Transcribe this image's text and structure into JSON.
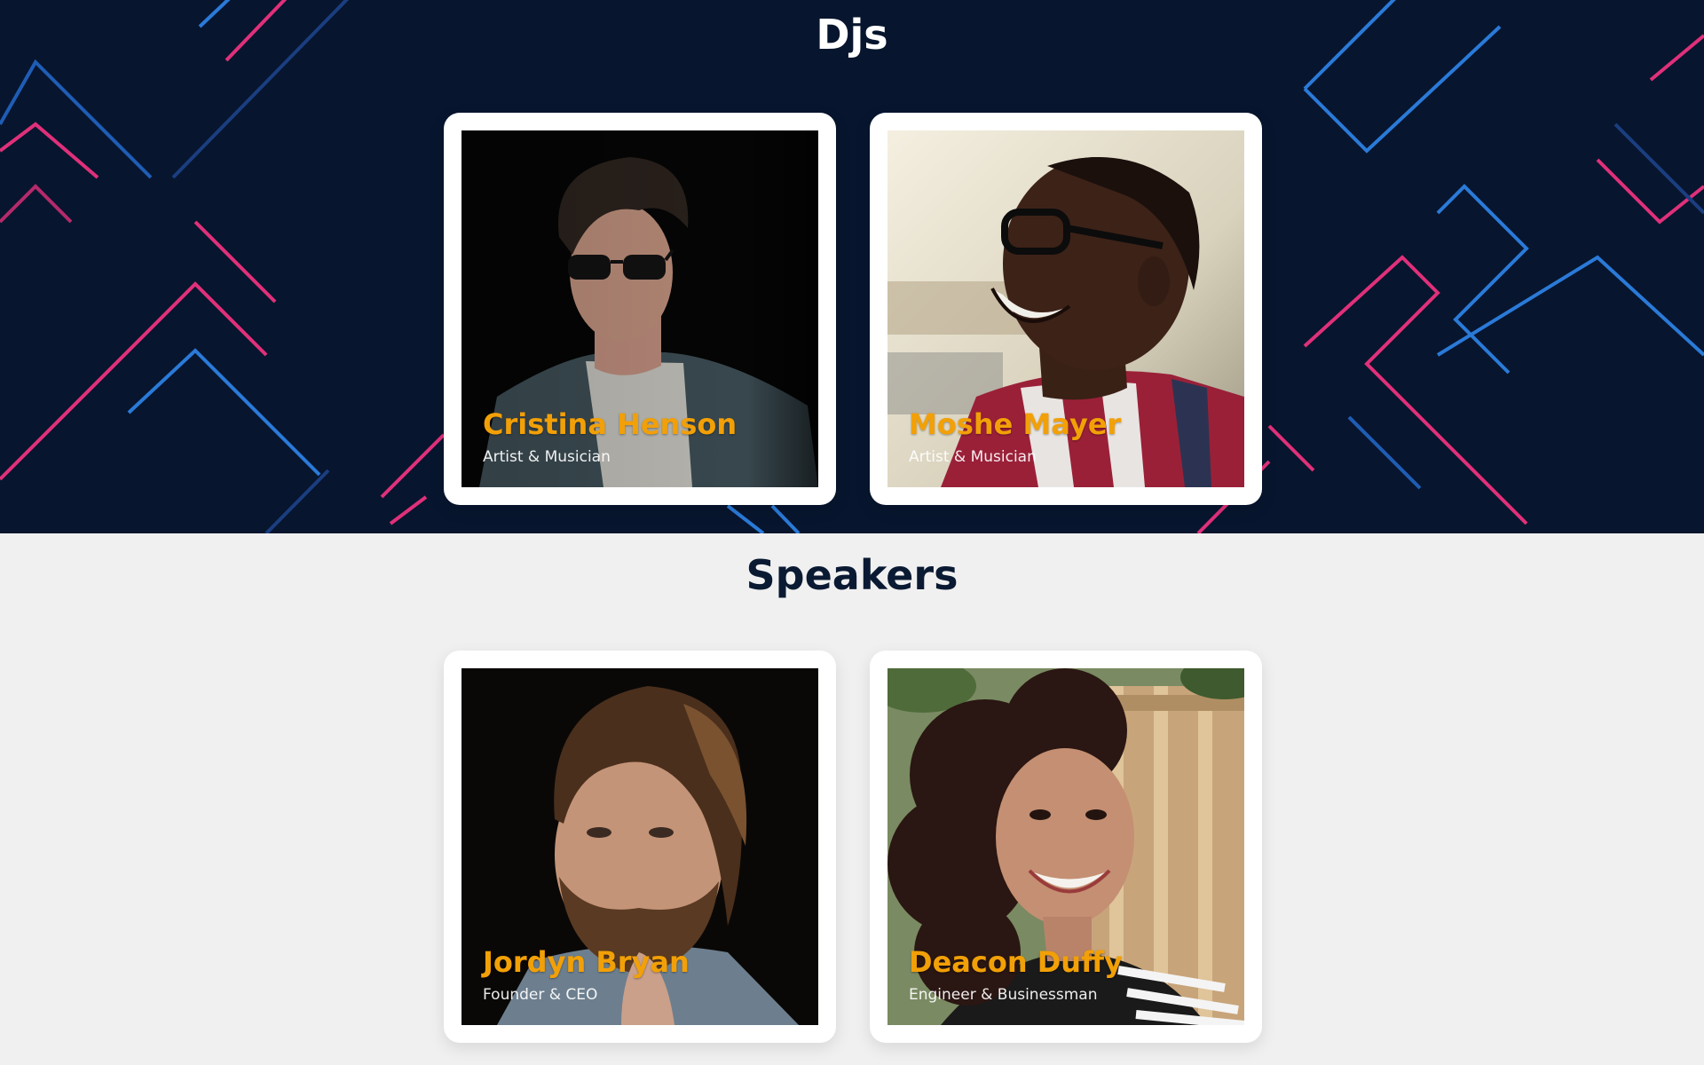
{
  "colors": {
    "dark_bg": "#07152e",
    "light_bg": "#f0f0f0",
    "name_accent": "#f2a007",
    "line_pink": "#e0307a",
    "line_blue": "#2a7ad8"
  },
  "djs": {
    "title": "Djs",
    "people": [
      {
        "name": "Cristina Henson",
        "role": "Artist & Musician",
        "photo": "man-with-sunglasses-photo"
      },
      {
        "name": "Moshe Mayer",
        "role": "Artist & Musician",
        "photo": "laughing-man-with-glasses-photo"
      }
    ]
  },
  "speakers": {
    "title": "Speakers",
    "people": [
      {
        "name": "Jordyn Bryan",
        "role": "Founder & CEO",
        "photo": "bearded-man-photo"
      },
      {
        "name": "Deacon Duffy",
        "role": "Engineer & Businessman",
        "photo": "smiling-woman-curly-hair-photo"
      }
    ]
  }
}
